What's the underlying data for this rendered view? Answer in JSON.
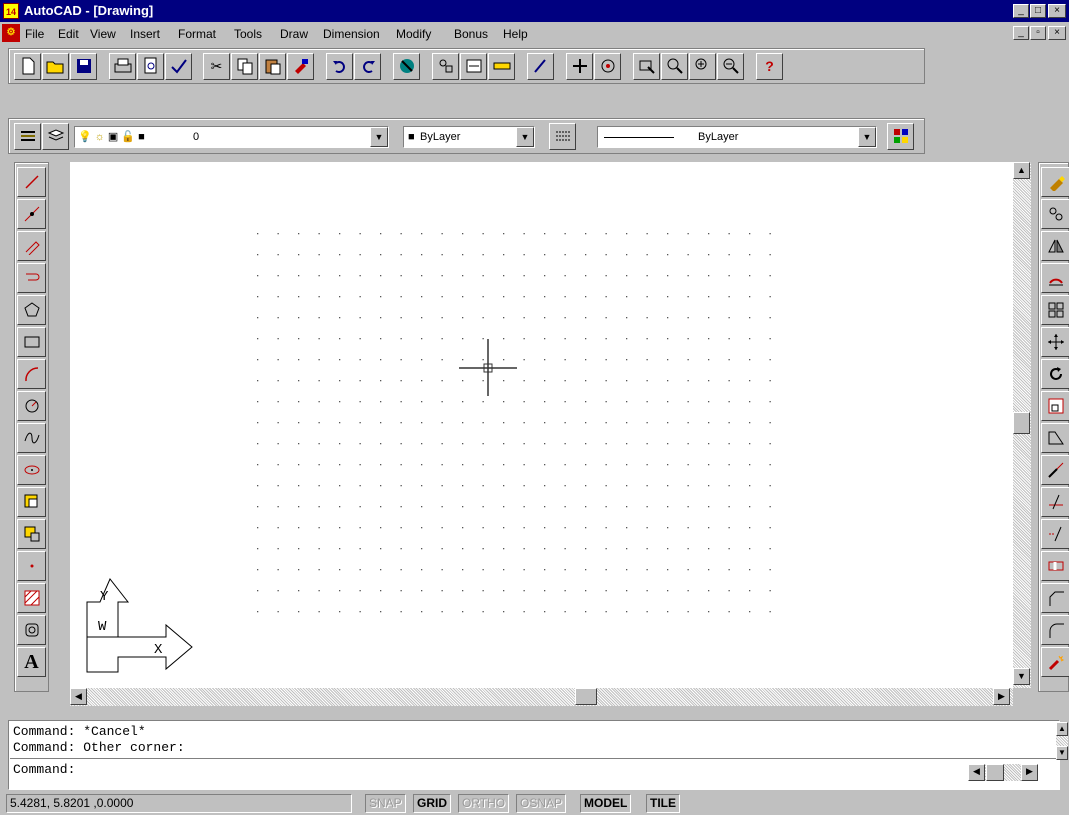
{
  "window": {
    "title": "AutoCAD - [Drawing]",
    "app_icon_text": "14",
    "minimize_glyph": "_",
    "maximize_glyph": "□",
    "close_glyph": "×",
    "doc_restore_glyph": "▫"
  },
  "menu": {
    "items": [
      "File",
      "Edit",
      "View",
      "Insert",
      "Format",
      "Tools",
      "Draw",
      "Dimension",
      "Modify",
      "Bonus",
      "Help"
    ]
  },
  "standard_toolbar": {
    "buttons": [
      "new-icon",
      "open-icon",
      "save-icon",
      "print-icon",
      "print-preview-icon",
      "spelling-icon",
      "cut-icon",
      "copy-icon",
      "paste-icon",
      "match-properties-icon",
      "undo-icon",
      "redo-icon",
      "launch-browser-icon",
      "object-snap-icon",
      "tracking-icon",
      "ucs-icon",
      "redraw-icon",
      "pan-icon",
      "aerial-view-icon",
      "zoom-window-icon",
      "zoom-realtime-icon",
      "zoom-icon",
      "zoom-previous-icon",
      "help-icon"
    ]
  },
  "object_properties_toolbar": {
    "layer_value": "0",
    "color_value": "ByLayer",
    "linetype_value": "ByLayer"
  },
  "draw_toolbar": {
    "tools": [
      "line-icon",
      "construction-line-icon",
      "polyline-icon",
      "3d-polyline-icon",
      "polygon-icon",
      "rectangle-icon",
      "arc-icon",
      "circle-icon",
      "spline-icon",
      "ellipse-icon",
      "insert-block-icon",
      "make-block-icon",
      "point-icon",
      "hatch-icon",
      "region-icon",
      "multiline-text-icon"
    ],
    "text_tool_label": "A"
  },
  "modify_toolbar": {
    "tools": [
      "erase-icon",
      "copy-object-icon",
      "mirror-icon",
      "offset-icon",
      "array-icon",
      "move-icon",
      "rotate-icon",
      "scale-icon",
      "stretch-icon",
      "lengthen-icon",
      "trim-icon",
      "extend-icon",
      "break-icon",
      "chamfer-icon",
      "fillet-icon",
      "explode-icon"
    ]
  },
  "ucs_icon": {
    "y_label": "Y",
    "w_label": "W",
    "x_label": "X"
  },
  "command": {
    "lines": [
      "Command: *Cancel*",
      "Command: Other corner:"
    ],
    "prompt": "Command:"
  },
  "status": {
    "coordinates": "5.4281, 5.8201 ,0.0000",
    "snap": "SNAP",
    "grid": "GRID",
    "ortho": "ORTHO",
    "osnap": "OSNAP",
    "model": "MODEL",
    "tile": "TILE"
  },
  "help_glyph": "?"
}
